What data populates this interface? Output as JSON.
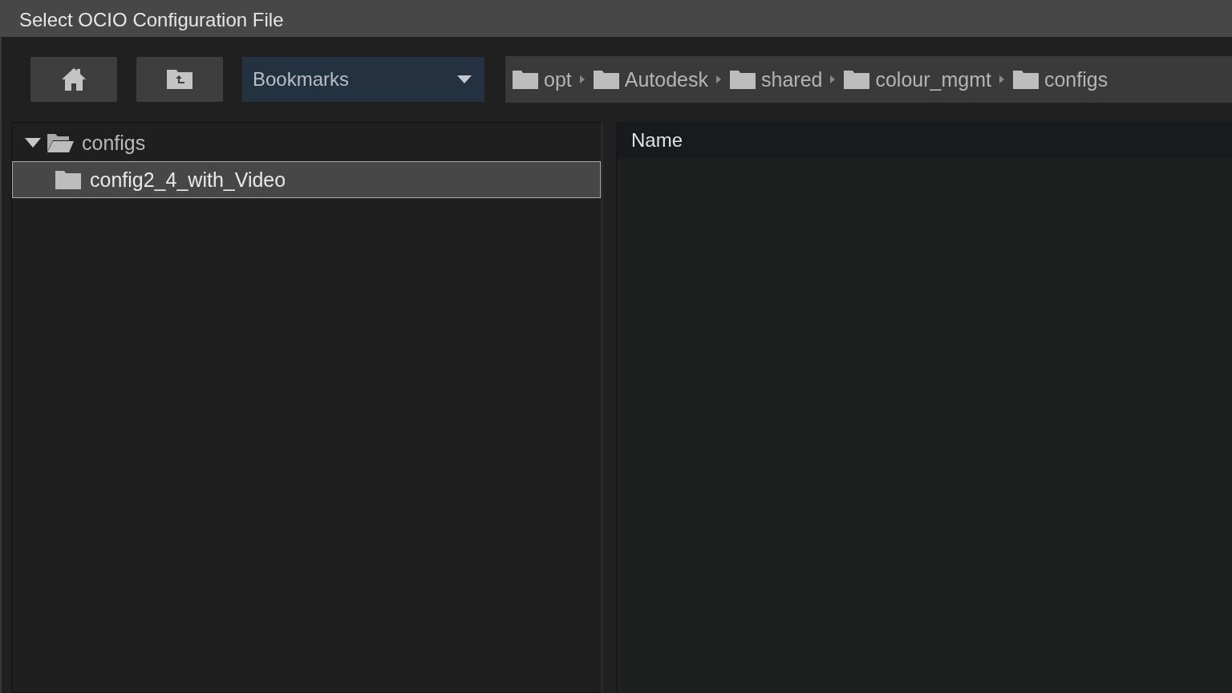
{
  "window": {
    "title": "Select OCIO Configuration File"
  },
  "bookmarks": {
    "value": "Bookmarks"
  },
  "breadcrumb": [
    {
      "label": "opt"
    },
    {
      "label": "Autodesk"
    },
    {
      "label": "shared"
    },
    {
      "label": "colour_mgmt"
    },
    {
      "label": "configs"
    }
  ],
  "tree": [
    {
      "label": "configs",
      "expanded": true,
      "selected": false,
      "children": [
        {
          "label": "config2_4_with_Video",
          "selected": true
        }
      ]
    }
  ],
  "file_list": {
    "columns": [
      "Name"
    ]
  }
}
